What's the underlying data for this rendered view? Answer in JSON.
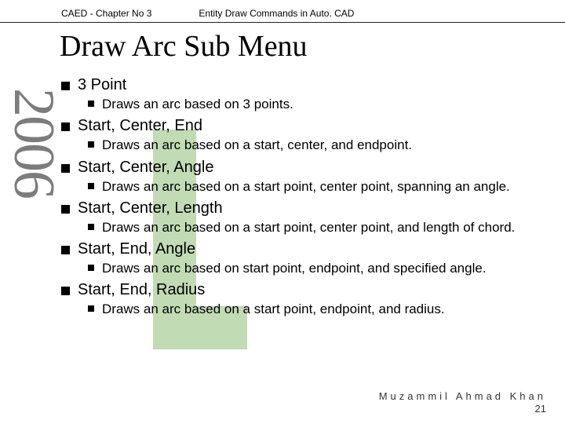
{
  "header": {
    "left": "CAED - Chapter No 3",
    "right": "Entity Draw Commands in Auto. CAD"
  },
  "title": "Draw Arc Sub Menu",
  "watermark_year": "2006",
  "items": [
    {
      "label": "3 Point",
      "desc": "Draws an arc based on 3 points."
    },
    {
      "label": "Start, Center, End",
      "desc": "Draws an arc based on a start, center, and endpoint."
    },
    {
      "label": "Start, Center, Angle",
      "desc": "Draws an arc based on a start point, center point, spanning an angle."
    },
    {
      "label": "Start, Center, Length",
      "desc": "Draws an arc based on a start point, center point, and length of chord."
    },
    {
      "label": "Start, End, Angle",
      "desc": "Draws an arc based on start point, endpoint, and specified angle."
    },
    {
      "label": "Start, End, Radius",
      "desc": "Draws an arc based on a start point, endpoint, and radius."
    }
  ],
  "footer": {
    "author": "Muzammil Ahmad Khan",
    "page": "21"
  }
}
